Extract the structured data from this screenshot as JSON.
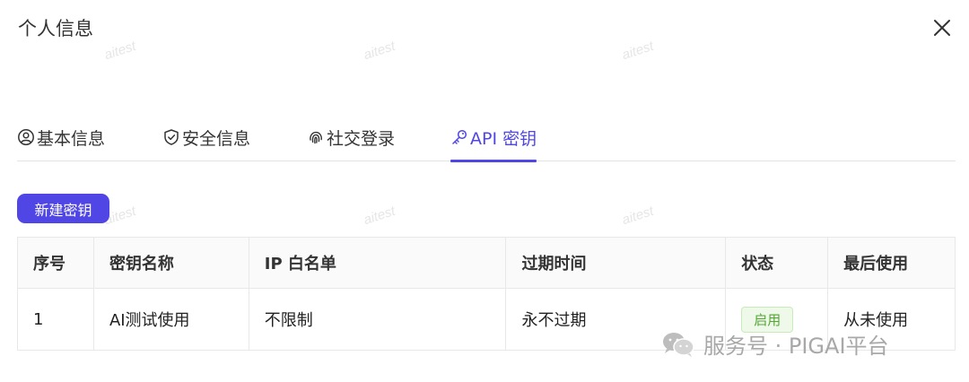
{
  "dialog": {
    "title": "个人信息"
  },
  "watermark": "aitest",
  "tabs": [
    {
      "label": "基本信息",
      "icon": "user-circle-icon"
    },
    {
      "label": "安全信息",
      "icon": "shield-icon"
    },
    {
      "label": "社交登录",
      "icon": "fingerprint-icon"
    },
    {
      "label": "API 密钥",
      "icon": "key-icon",
      "active": true
    }
  ],
  "toolbar": {
    "new_key_label": "新建密钥"
  },
  "table": {
    "headers": [
      "序号",
      "密钥名称",
      "IP 白名单",
      "过期时间",
      "状态",
      "最后使用"
    ],
    "rows": [
      {
        "index": "1",
        "name": "AI测试使用",
        "ip_whitelist": "不限制",
        "expires": "永不过期",
        "status": "启用",
        "last_used": "从未使用"
      }
    ]
  },
  "footer": {
    "brand": "服务号 · PIGAI平台"
  },
  "colors": {
    "accent": "#4f46e5",
    "status_green": "#52a832"
  }
}
